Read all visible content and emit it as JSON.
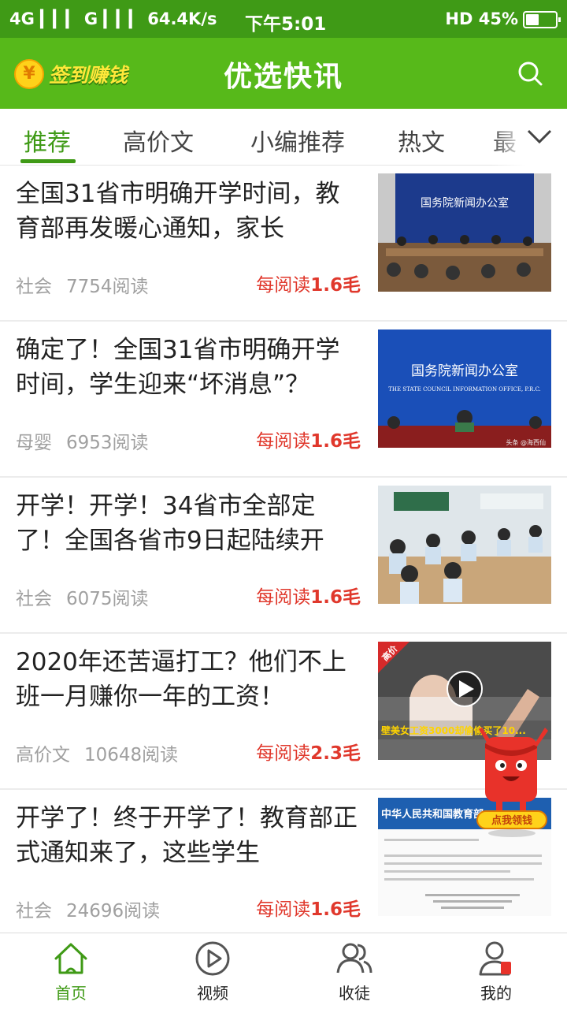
{
  "status_bar": {
    "left": "4G ▎▎▎ G ▎▎▎ 64.4K/s",
    "time": "下午5:01",
    "right": "HD 45%",
    "battery_level": 0.45
  },
  "header": {
    "checkin_label": "签到赚钱",
    "coin_symbol": "¥",
    "title": "优选快讯",
    "search_icon": "search-icon"
  },
  "tabs": {
    "items": [
      {
        "label": "推荐",
        "active": true
      },
      {
        "label": "高价文",
        "active": false
      },
      {
        "label": "小编推荐",
        "active": false
      },
      {
        "label": "热文",
        "active": false
      },
      {
        "label": "最",
        "active": false
      }
    ],
    "more_icon": "chevron-down-icon"
  },
  "articles": [
    {
      "title": "全国31省市明确开学时间，教育部再发暖心通知，家长",
      "category": "社会",
      "reads": "7754阅读",
      "reward_prefix": "每阅读",
      "reward_value": "1.6毛",
      "thumb_text": "国务院新闻办公室"
    },
    {
      "title": "确定了！全国31省市明确开学时间，学生迎来“坏消息”？",
      "category": "母婴",
      "reads": "6953阅读",
      "reward_prefix": "每阅读",
      "reward_value": "1.6毛",
      "thumb_text": "国务院新闻办公室",
      "thumb_sub": "THE STATE COUNCIL INFORMATION OFFICE, P.R.C.",
      "thumb_credit": "头条 @海西仙"
    },
    {
      "title": "开学！开学！34省市全部定了！全国各省市9日起陆续开",
      "category": "社会",
      "reads": "6075阅读",
      "reward_prefix": "每阅读",
      "reward_value": "1.6毛"
    },
    {
      "title": "2020年还苦逼打工？他们不上班一月赚你一年的工资！",
      "category": "高价文",
      "reads": "10648阅读",
      "reward_prefix": "每阅读",
      "reward_value": "2.3毛",
      "thumb_badge": "高价",
      "thumb_caption": "壁美女工资3000却偷偷买了10..."
    },
    {
      "title": "开学了！终于开学了！教育部正式通知来了，这些学生",
      "category": "社会",
      "reads": "24696阅读",
      "reward_prefix": "每阅读",
      "reward_value": "1.6毛",
      "thumb_text": "中华人民共和国教育部"
    }
  ],
  "floating_promo": {
    "label": "点我领钱"
  },
  "bottom_nav": [
    {
      "label": "首页",
      "icon": "home-icon",
      "active": true
    },
    {
      "label": "视频",
      "icon": "play-circle-icon",
      "active": false
    },
    {
      "label": "收徒",
      "icon": "users-icon",
      "active": false
    },
    {
      "label": "我的",
      "icon": "user-icon",
      "active": false
    }
  ],
  "colors": {
    "brand_green": "#57b91a",
    "active_green": "#3f9a16",
    "reward_red": "#e0382c"
  }
}
